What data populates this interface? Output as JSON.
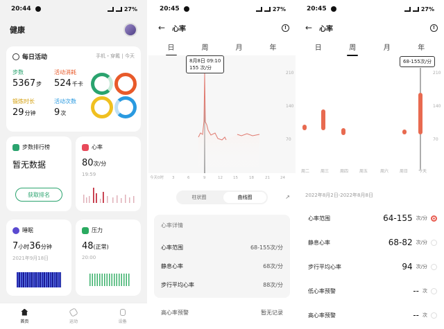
{
  "panel1": {
    "status": {
      "time": "20:44",
      "battery": "27%"
    },
    "title": "健康",
    "daily": {
      "title": "每日活动",
      "source": "手机・穿戴 | 今天",
      "steps_label": "步数",
      "steps_value": "5367",
      "steps_unit": "步",
      "cal_label": "活动消耗",
      "cal_value": "524",
      "cal_unit": "千卡",
      "ex_label": "锻炼时长",
      "ex_value": "29",
      "ex_unit": "分钟",
      "act_label": "活动次数",
      "act_value": "9",
      "act_unit": "次"
    },
    "rank": {
      "title": "步数排行榜",
      "value": "暂无数据",
      "button": "获取排名"
    },
    "heart": {
      "title": "心率",
      "value": "80",
      "unit": "次/分",
      "time": "19:59"
    },
    "sleep": {
      "title": "睡眠",
      "h": "7",
      "h_unit": "小时",
      "m": "36",
      "m_unit": "分钟",
      "date": "2021年9月18日"
    },
    "stress": {
      "title": "压力",
      "value": "48",
      "level": "(正常)",
      "time": "20:00"
    },
    "nav": [
      "首页",
      "运动",
      "设备"
    ],
    "colors": {
      "steps": "#2aa36e",
      "cal": "#e85a2a",
      "ex": "#e8b820",
      "act": "#2a9ae0"
    }
  },
  "panel2": {
    "status": {
      "time": "20:45",
      "battery": "27%"
    },
    "title": "心率",
    "tabs": [
      "日",
      "周",
      "月",
      "年"
    ],
    "tooltip_date": "8月8日 09:10",
    "tooltip_value": "155 次/分",
    "y_ticks": [
      "210",
      "140",
      "70"
    ],
    "x_ticks": [
      "今天0时",
      "3",
      "6",
      "9",
      "12",
      "15",
      "18",
      "21",
      "24"
    ],
    "toggle": [
      "柱状图",
      "曲线图"
    ],
    "detail": {
      "title": "心率详情",
      "rows": [
        {
          "label": "心率范围",
          "value": "68-155次/分"
        },
        {
          "label": "静息心率",
          "value": "68次/分"
        },
        {
          "label": "步行平均心率",
          "value": "88次/分"
        }
      ],
      "alert_label": "高心率预警",
      "alert_value": "暂无记录"
    }
  },
  "panel3": {
    "status": {
      "time": "20:45",
      "battery": "27%"
    },
    "title": "心率",
    "tabs": [
      "日",
      "周",
      "月",
      "年"
    ],
    "tooltip": "68-155次/分",
    "y_ticks": [
      "210",
      "140",
      "70"
    ],
    "days": [
      "周二",
      "周三",
      "周四",
      "周五",
      "周六",
      "周日",
      "今天"
    ],
    "range": "2022年8月2日-2022年8月8日",
    "rows": [
      {
        "label": "心率范围",
        "num": "64-155",
        "unit": "次/分"
      },
      {
        "label": "静息心率",
        "num": "68-82",
        "unit": "次/分"
      },
      {
        "label": "步行平均心率",
        "num": "94",
        "unit": "次/分"
      },
      {
        "label": "低心率预警",
        "num": "--",
        "unit": "次"
      },
      {
        "label": "高心率预警",
        "num": "--",
        "unit": "次"
      }
    ]
  }
}
